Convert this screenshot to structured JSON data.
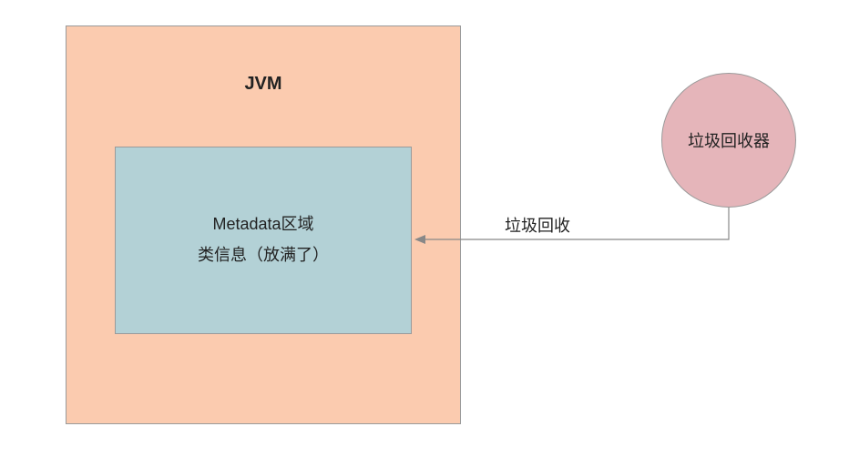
{
  "jvm": {
    "title": "JVM"
  },
  "metadata": {
    "line1": "Metadata区域",
    "line2": "类信息（放满了）"
  },
  "gc_circle": {
    "label": "垃圾回收器"
  },
  "arrow": {
    "label": "垃圾回收"
  }
}
